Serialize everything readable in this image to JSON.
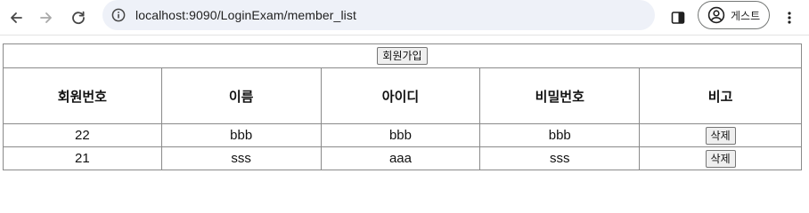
{
  "browser": {
    "url": "localhost:9090/LoginExam/member_list",
    "profile_label": "게스트"
  },
  "join_button_label": "회원가입",
  "table": {
    "headers": [
      "회원번호",
      "이름",
      "아이디",
      "비밀번호",
      "비고"
    ],
    "rows": [
      {
        "no": "22",
        "name": "bbb",
        "id": "bbb",
        "password": "bbb",
        "action": "삭제"
      },
      {
        "no": "21",
        "name": "sss",
        "id": "aaa",
        "password": "sss",
        "action": "삭제"
      }
    ]
  }
}
